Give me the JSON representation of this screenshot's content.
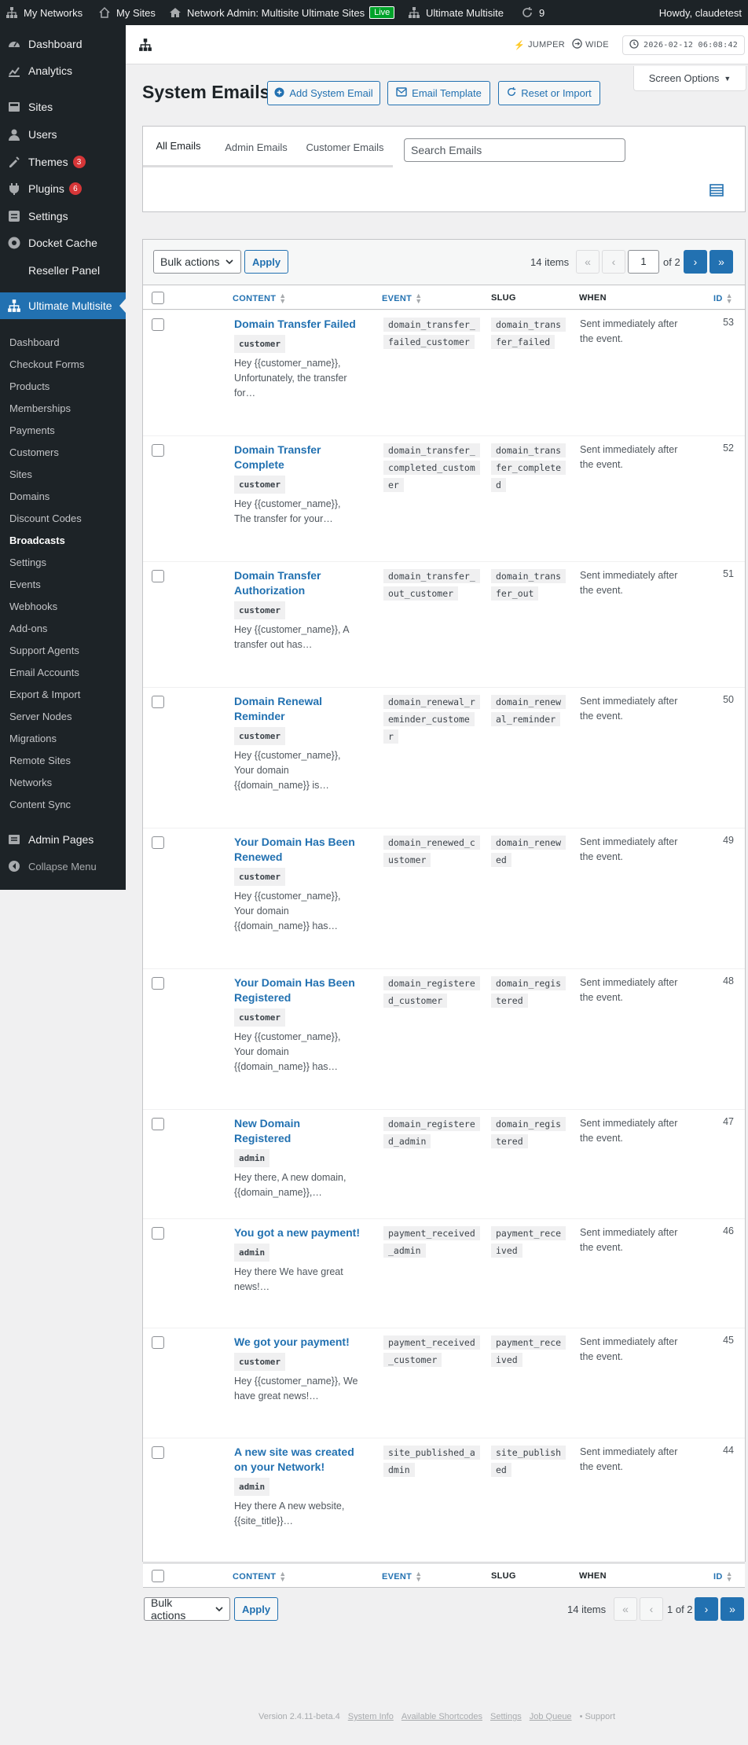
{
  "adminbar": {
    "my_networks": "My Networks",
    "my_sites": "My Sites",
    "network_admin": "Network Admin: Multisite Ultimate Sites",
    "live": "Live",
    "ultimate_multisite": "Ultimate Multisite",
    "updates_count": "9",
    "howdy": "Howdy, claudetest"
  },
  "sidebar": {
    "items": [
      {
        "label": "Dashboard",
        "icon": "dashboard-icon"
      },
      {
        "label": "Analytics",
        "icon": "analytics-icon"
      },
      {
        "label": "Sites",
        "icon": "sites-icon"
      },
      {
        "label": "Users",
        "icon": "users-icon"
      },
      {
        "label": "Themes",
        "icon": "themes-icon",
        "badge": "3"
      },
      {
        "label": "Plugins",
        "icon": "plugins-icon",
        "badge": "6"
      },
      {
        "label": "Settings",
        "icon": "settings-icon"
      },
      {
        "label": "Docket Cache",
        "icon": "docket-cache-icon"
      },
      {
        "label": "Reseller Panel",
        "icon": ""
      },
      {
        "label": "Ultimate Multisite",
        "icon": "network-icon"
      }
    ],
    "submenu": [
      "Dashboard",
      "Checkout Forms",
      "Products",
      "Memberships",
      "Payments",
      "Customers",
      "Sites",
      "Domains",
      "Discount Codes",
      "Broadcasts",
      "Settings",
      "Events",
      "Webhooks",
      "Add-ons",
      "Support Agents",
      "Email Accounts",
      "Export & Import",
      "Server Nodes",
      "Migrations",
      "Remote Sites",
      "Networks",
      "Content Sync"
    ],
    "admin_pages": "Admin Pages",
    "collapse": "Collapse Menu"
  },
  "topbar": {
    "jumper": "JUMPER",
    "wide": "WIDE",
    "clock": "2026-02-12 06:08:42"
  },
  "screen_options": "Screen Options",
  "page": {
    "title": "System Emails",
    "add_button": "Add System Email",
    "template_button": "Email Template",
    "reset_button": "Reset or Import"
  },
  "filters": {
    "tabs": [
      "All Emails",
      "Admin Emails",
      "Customer Emails"
    ],
    "search_placeholder": "Search Emails"
  },
  "table": {
    "bulk_actions": "Bulk actions",
    "apply": "Apply",
    "items_count": "14 items",
    "current_page": "1",
    "of_pages": "of 2",
    "bottom_pages": "1 of 2",
    "columns": {
      "content": "CONTENT",
      "event": "EVENT",
      "slug": "SLUG",
      "when": "WHEN",
      "id": "ID"
    },
    "rows": [
      {
        "title": "Domain Transfer Failed",
        "target": "customer",
        "excerpt": "Hey {{customer_name}}, Unfortunately, the transfer for…",
        "event": "domain_transfer_failed_customer",
        "slug": "domain_transfer_failed",
        "when": "Sent immediately after the event.",
        "id": "53"
      },
      {
        "title": "Domain Transfer Complete",
        "target": "customer",
        "excerpt": "Hey {{customer_name}}, The transfer for your…",
        "event": "domain_transfer_completed_customer",
        "slug": "domain_transfer_completed",
        "when": "Sent immediately after the event.",
        "id": "52"
      },
      {
        "title": "Domain Transfer Authorization",
        "target": "customer",
        "excerpt": "Hey {{customer_name}}, A transfer out has…",
        "event": "domain_transfer_out_customer",
        "slug": "domain_transfer_out",
        "when": "Sent immediately after the event.",
        "id": "51"
      },
      {
        "title": "Domain Renewal Reminder",
        "target": "customer",
        "excerpt": "Hey {{customer_name}}, Your domain {{domain_name}} is…",
        "event": "domain_renewal_reminder_customer",
        "slug": "domain_renewal_reminder",
        "when": "Sent immediately after the event.",
        "id": "50"
      },
      {
        "title": "Your Domain Has Been Renewed",
        "target": "customer",
        "excerpt": "Hey {{customer_name}}, Your domain {{domain_name}} has…",
        "event": "domain_renewed_customer",
        "slug": "domain_renewed",
        "when": "Sent immediately after the event.",
        "id": "49"
      },
      {
        "title": "Your Domain Has Been Registered",
        "target": "customer",
        "excerpt": "Hey {{customer_name}}, Your domain {{domain_name}} has…",
        "event": "domain_registered_customer",
        "slug": "domain_registered",
        "when": "Sent immediately after the event.",
        "id": "48"
      },
      {
        "title": "New Domain Registered",
        "target": "admin",
        "excerpt": "Hey there, A new domain, {{domain_name}},…",
        "event": "domain_registered_admin",
        "slug": "domain_registered",
        "when": "Sent immediately after the event.",
        "id": "47"
      },
      {
        "title": "You got a new payment!",
        "target": "admin",
        "excerpt": "Hey there We have great news!…",
        "event": "payment_received_admin",
        "slug": "payment_received",
        "when": "Sent immediately after the event.",
        "id": "46"
      },
      {
        "title": "We got your payment!",
        "target": "customer",
        "excerpt": "Hey {{customer_name}}, We have great news!…",
        "event": "payment_received_customer",
        "slug": "payment_received",
        "when": "Sent immediately after the event.",
        "id": "45"
      },
      {
        "title": "A new site was created on your Network!",
        "target": "admin",
        "excerpt": "Hey there A new website, {{site_title}}…",
        "event": "site_published_admin",
        "slug": "site_published",
        "when": "Sent immediately after the event.",
        "id": "44"
      }
    ]
  },
  "footer": {
    "version": "Version 2.4.11-beta.4",
    "links": [
      "System Info",
      "Available Shortcodes",
      "Settings",
      "Job Queue"
    ],
    "support": "• Support"
  }
}
